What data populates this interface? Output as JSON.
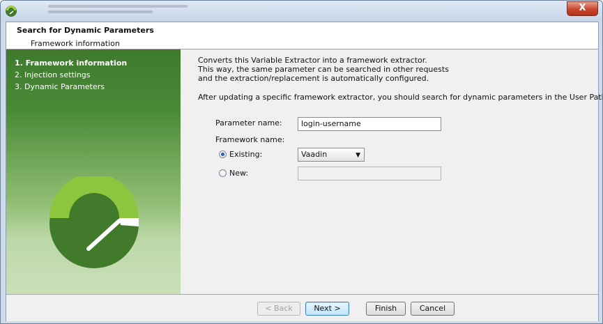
{
  "window": {
    "icon": "app-logo-icon",
    "close_label": "X"
  },
  "header": {
    "title": "Search for Dynamic Parameters",
    "subtitle": "Framework information"
  },
  "sidebar": {
    "steps": [
      {
        "label": "1. Framework information",
        "active": true
      },
      {
        "label": "2. Injection settings",
        "active": false
      },
      {
        "label": "3. Dynamic Parameters",
        "active": false
      }
    ]
  },
  "main": {
    "description": [
      "Converts this Variable Extractor into a framework extractor.",
      "This way, the same parameter can be searched in other requests",
      "and the extraction/replacement is automatically configured."
    ],
    "note": "After updating a specific framework extractor, you should search for dynamic parameters in the User Path.",
    "parameter_name_label": "Parameter name:",
    "parameter_name_value": "login-username",
    "framework_name_label": "Framework name:",
    "existing_label": "Existing:",
    "existing_value": "Vaadin",
    "new_label": "New:",
    "new_value": ""
  },
  "footer": {
    "back": "< Back",
    "next": "Next >",
    "finish": "Finish",
    "cancel": "Cancel"
  },
  "colors": {
    "sidebar_top": "#3f7a2c",
    "sidebar_bottom": "#c9e0b8",
    "gauge_green": "#417a2b",
    "gauge_lime": "#8cc63f"
  }
}
